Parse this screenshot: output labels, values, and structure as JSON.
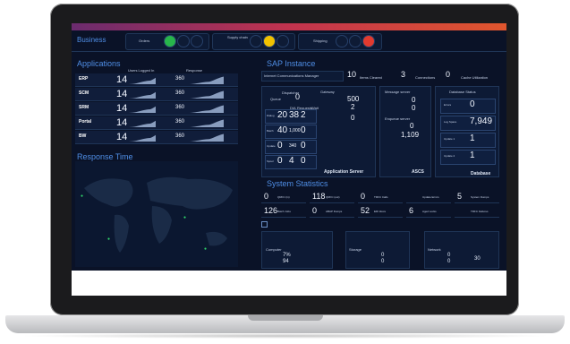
{
  "business": {
    "title": "Business",
    "orders": "Orders",
    "supply": "Supply chain",
    "shipping": "Shipping"
  },
  "colors": {
    "green": "#28b54b",
    "yellow": "#f2c200",
    "red": "#e23a2f",
    "accent": "#4f8ee6"
  },
  "applications": {
    "title": "Applications",
    "col_users": "Users Logged In",
    "col_response": "Response",
    "rows": [
      {
        "name": "ERP",
        "users": "14",
        "response": "360"
      },
      {
        "name": "SCM",
        "users": "14",
        "response": "360"
      },
      {
        "name": "SRM",
        "users": "14",
        "response": "360"
      },
      {
        "name": "Portal",
        "users": "14",
        "response": "360"
      },
      {
        "name": "BW",
        "users": "14",
        "response": "360"
      }
    ]
  },
  "response_time": {
    "title": "Response Time"
  },
  "sap": {
    "title": "SAP Instance",
    "icm": "Internet Communications Manager",
    "icm_value": "10",
    "stat_labels": [
      "Items Cleared",
      "3",
      "Connections",
      "0",
      "Cache Utilization"
    ],
    "dispatcher": "Dispatcher",
    "dispatcher_value": "0",
    "queue": "Queue",
    "dia": "DIA",
    "requests": "Requests",
    "waits": "Wait",
    "dia_row": [
      "20",
      "38",
      "2"
    ],
    "batch_row": [
      "40",
      "1,000",
      "0"
    ],
    "update_row": [
      "0",
      "340",
      "0"
    ],
    "spool_row": [
      "0",
      "4",
      "0"
    ],
    "row_labels": [
      "Dialog",
      "Batch",
      "Update",
      "Spool"
    ],
    "gateway": "Gateway",
    "gw_used": "500",
    "gw_current": "2",
    "gw_interrupted": "0",
    "app_server": "Application Server",
    "msg": "Message server",
    "msg_vals": [
      "0",
      "0"
    ],
    "enqueue": "Enqueue server",
    "enqueue_vals": [
      "0",
      "1,109"
    ],
    "ascs": "ASCS",
    "db": "Database Status",
    "db_rows": [
      {
        "label": "Errors",
        "value": "0"
      },
      {
        "label": "Log Space",
        "value": "7,949"
      },
      {
        "label": "Update 1",
        "value": "1"
      },
      {
        "label": "Update 2",
        "value": "1"
      }
    ],
    "database": "Database"
  },
  "system": {
    "title": "System Statistics",
    "row1": [
      {
        "v": "0",
        "l": "QRFC (in)"
      },
      {
        "v": "118",
        "l": "QRFC (out)"
      },
      {
        "v": "0",
        "l": "TRFC Calls"
      },
      {
        "v": "",
        "l": "Update Errors"
      },
      {
        "v": "5",
        "l": "System Dumps"
      }
    ],
    "row2": [
      {
        "v": "126",
        "l": "Batch Jobs"
      },
      {
        "v": "0",
        "l": "ABAP Dumps"
      },
      {
        "v": "52",
        "l": "EDI Idocs"
      },
      {
        "v": "6",
        "l": "Aged Locks"
      },
      {
        "v": "",
        "l": "TRFC Failures"
      }
    ]
  },
  "bottom": {
    "cpu": {
      "title": "Computer",
      "a": "7%",
      "b": "94"
    },
    "storage": {
      "title": "Storage",
      "a": "0",
      "b": "0"
    },
    "network": {
      "title": "Network",
      "a": "0",
      "b": "0",
      "c": "30"
    }
  }
}
